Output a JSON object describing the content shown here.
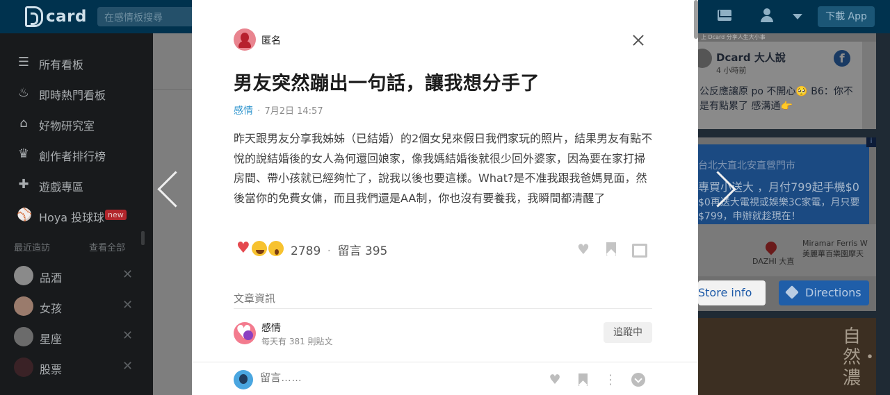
{
  "app": {
    "logo": "card",
    "search_placeholder": "在感情板搜尋",
    "download_label": "下載 App"
  },
  "sidebar": {
    "items": [
      {
        "icon": "list-icon",
        "label": "所有看板"
      },
      {
        "icon": "fire-icon",
        "label": "即時熱門看板"
      },
      {
        "icon": "store-icon",
        "label": "好物研究室"
      },
      {
        "icon": "trophy-icon",
        "label": "創作者排行榜"
      },
      {
        "icon": "gamepad-icon",
        "label": "遊戲專區"
      },
      {
        "icon": "baseball-icon",
        "label": "Hoya 投球球",
        "badge": "new"
      }
    ],
    "recent_heading": "最近造訪",
    "recent_all": "查看全部",
    "recent": [
      {
        "label": "品酒"
      },
      {
        "label": "女孩"
      },
      {
        "label": "星座"
      },
      {
        "label": "股票"
      }
    ]
  },
  "ads": {
    "fb_post": {
      "top_text": "上 Dcard 分享人生大小事",
      "name": "Dcard 大人說",
      "time": "4 小時前",
      "text": "公反應讓原 po 不開心🥺 B6：你不是有點累了 感溝通👉"
    },
    "banner": {
      "line1": "台北大直北安直營門市",
      "line2": "專買小送大 ，月付799起手機$0",
      "line3": "$0再送大電視或娛樂3C家電，月只要$799，申辦就趁現在！",
      "ad_mark": "i"
    },
    "map": {
      "label1": "Miramar Ferris W 美麗華百樂園摩天",
      "label2": "DAZHI 大直"
    },
    "buttons": {
      "store": "Store info",
      "directions": "Directions"
    },
    "ad3_text": "自然・濃"
  },
  "post": {
    "author": "匿名",
    "title": "男友突然蹦出一句話，讓我想分手了",
    "forum": "感情",
    "date": "7月2日 14:57",
    "body": "昨天跟男友分享我姊姊（已結婚）的2個女兒來假日我們家玩的照片，結果男友有點不悅的說結婚後的女人為何還回娘家，像我媽結婚後就很少回外婆家，因為要在家打掃房間、帶小孩就已經夠忙了，說我以後也要這樣。What?是不准我跟我爸媽見面，然後當你的免費女傭，而且我們還是AA制，你也沒有要養我，我瞬間都清醒了",
    "reaction_count": "2789",
    "comment_label": "留言 395",
    "separator": "·"
  },
  "article_info": {
    "heading": "文章資訊",
    "forum_name": "感情",
    "forum_sub": "每天有 381 則貼文",
    "follow_label": "追蹤中"
  },
  "comment_bar": {
    "placeholder": "留言……"
  },
  "colors": {
    "brand": "#00324e",
    "forum_link": "#3397cf",
    "heart": "#e5494f"
  }
}
